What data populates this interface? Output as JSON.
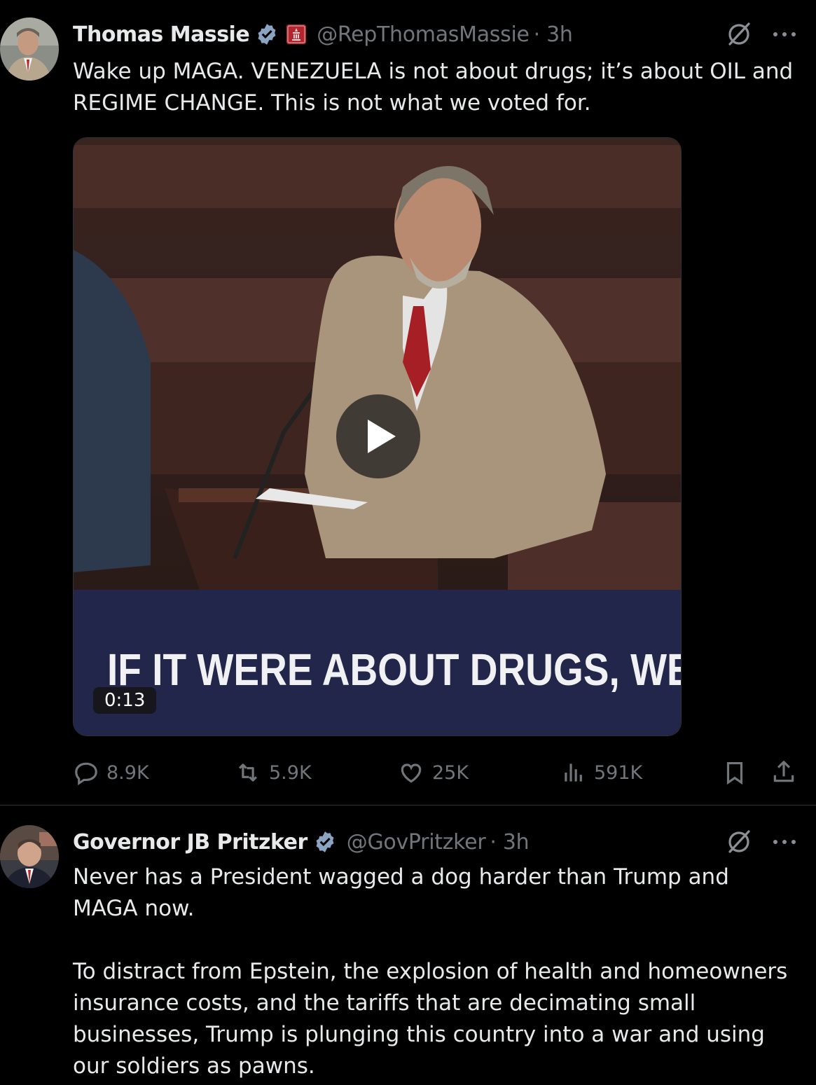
{
  "tweets": [
    {
      "author": "Thomas Massie",
      "handle": "@RepThomasMassie",
      "time": "· 3h",
      "text": "Wake up MAGA. VENEZUELA is not about drugs; it’s about OIL and REGIME CHANGE. This is not what we voted for.",
      "media": {
        "caption": "IF IT WERE ABOUT DRUGS, WE'D",
        "duration": "0:13"
      },
      "stats": {
        "replies": "8.9K",
        "reposts": "5.9K",
        "likes": "25K",
        "views": "591K"
      }
    },
    {
      "author": "Governor JB Pritzker",
      "handle": "@GovPritzker",
      "time": "· 3h",
      "text": "Never has a President wagged a dog harder than Trump and MAGA now.\n\nTo distract from Epstein, the explosion of health and homeowners insurance costs, and the tariffs that are decimating small businesses, Trump is plunging this country into a war and using our soldiers as pawns."
    }
  ],
  "colors": {
    "background": "#000000",
    "text": "#e7e9ea",
    "muted": "#71767b",
    "verified": "#1d9bf0",
    "divider": "#2f3336"
  },
  "icons": [
    "verified-badge-icon",
    "government-affiliation-icon",
    "grok-icon",
    "more-icon",
    "reply-icon",
    "repost-icon",
    "like-icon",
    "views-icon",
    "bookmark-icon",
    "share-icon",
    "play-icon"
  ]
}
